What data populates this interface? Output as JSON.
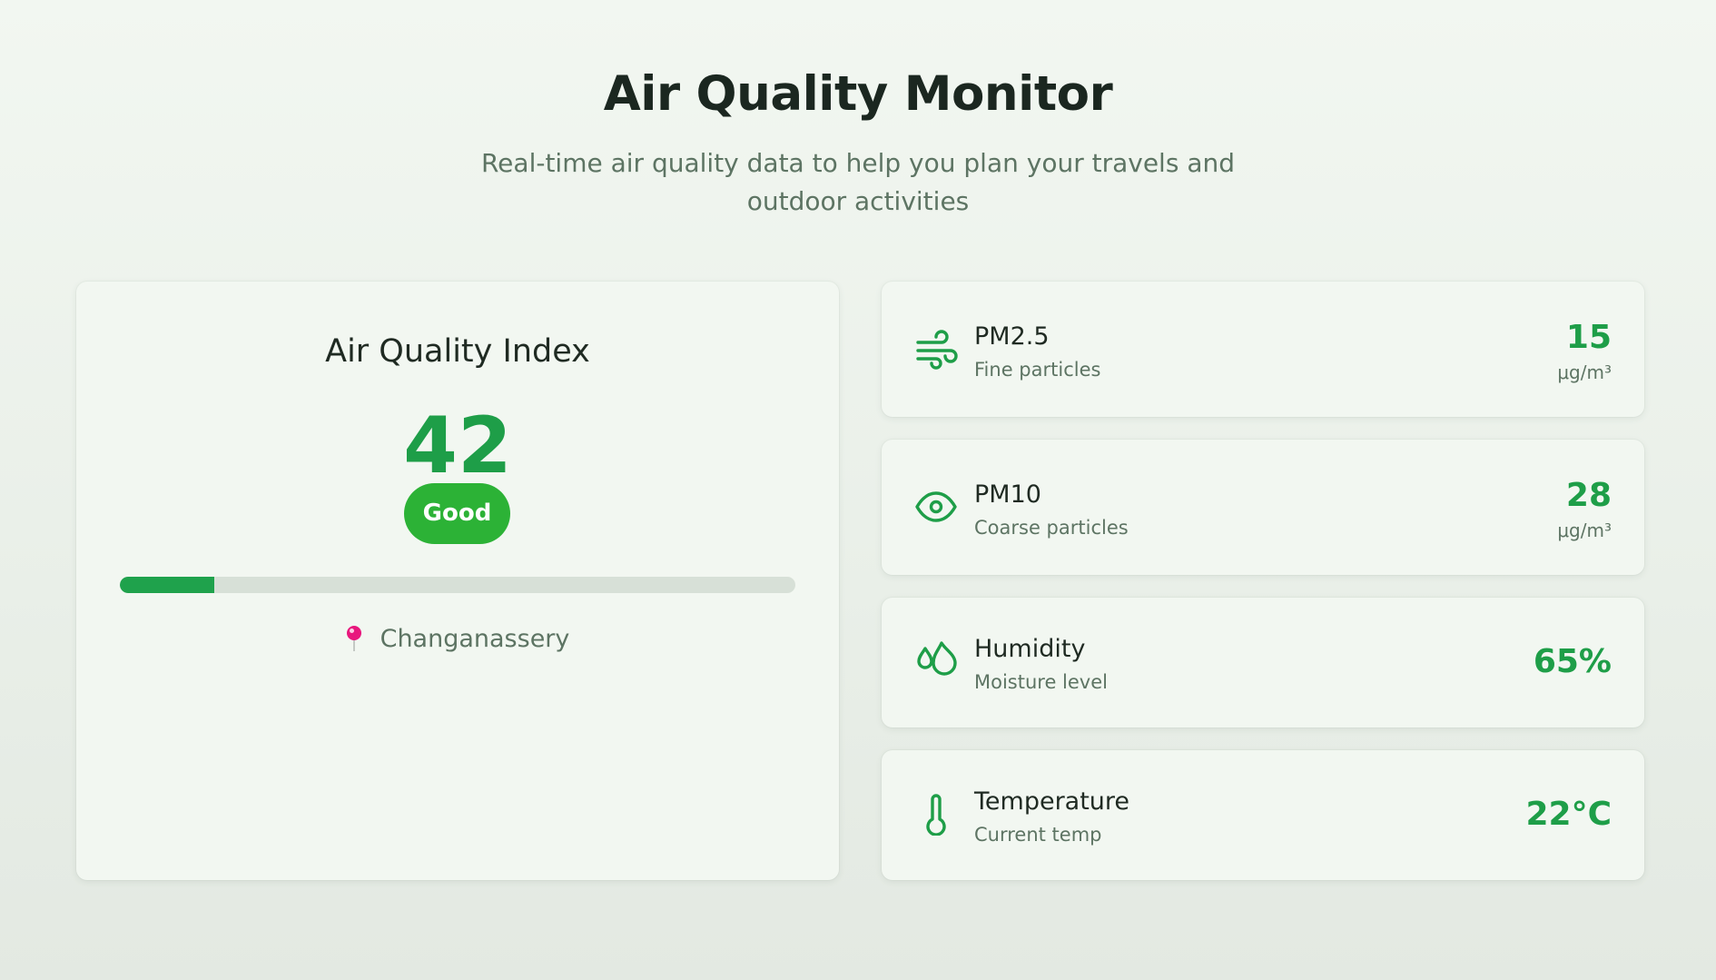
{
  "header": {
    "title": "Air Quality Monitor",
    "subtitle": "Real-time air quality data to help you plan your travels and outdoor activities"
  },
  "aqi": {
    "heading": "Air Quality Index",
    "value": "42",
    "status": "Good",
    "level_fraction": 0.14,
    "location": "Changanassery",
    "location_icon": "pin-icon"
  },
  "metrics": [
    {
      "icon": "wind-icon",
      "name": "PM2.5",
      "description": "Fine particles",
      "value": "15",
      "unit": "μg/m³"
    },
    {
      "icon": "eye-icon",
      "name": "PM10",
      "description": "Coarse particles",
      "value": "28",
      "unit": "μg/m³"
    },
    {
      "icon": "droplets-icon",
      "name": "Humidity",
      "description": "Moisture level",
      "value": "65%",
      "unit": ""
    },
    {
      "icon": "thermometer-icon",
      "name": "Temperature",
      "description": "Current temp",
      "value": "22°C",
      "unit": ""
    }
  ],
  "colors": {
    "accent": "#1e9e48",
    "badge": "#2cb236",
    "pin": "#e8177d",
    "text_muted": "#5d7463",
    "card_background": "#f2f7f1"
  }
}
